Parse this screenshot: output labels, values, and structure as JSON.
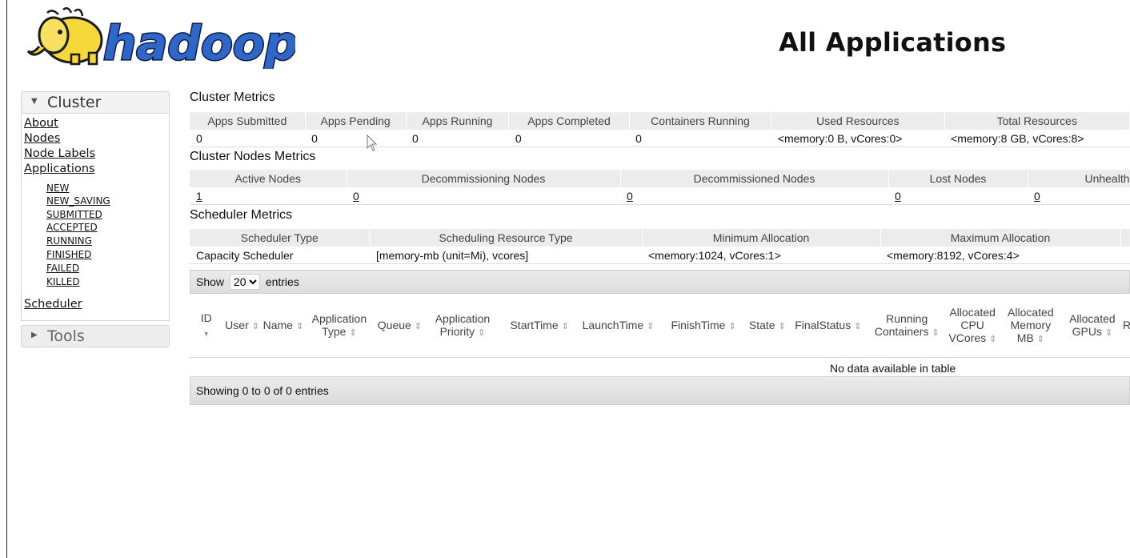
{
  "header": {
    "logo_text": "hadoop",
    "title": "All Applications"
  },
  "sidebar": {
    "cluster_label": "Cluster",
    "links": [
      "About",
      "Nodes",
      "Node Labels",
      "Applications"
    ],
    "app_states": [
      "NEW",
      "NEW_SAVING",
      "SUBMITTED",
      "ACCEPTED",
      "RUNNING",
      "FINISHED",
      "FAILED",
      "KILLED"
    ],
    "scheduler_label": "Scheduler",
    "tools_label": "Tools"
  },
  "cluster_metrics": {
    "title": "Cluster Metrics",
    "headers": [
      "Apps Submitted",
      "Apps Pending",
      "Apps Running",
      "Apps Completed",
      "Containers Running",
      "Used Resources",
      "Total Resources"
    ],
    "values": [
      "0",
      "0",
      "0",
      "0",
      "0",
      "<memory:0 B, vCores:0>",
      "<memory:8 GB, vCores:8>"
    ]
  },
  "cluster_nodes_metrics": {
    "title": "Cluster Nodes Metrics",
    "headers": [
      "Active Nodes",
      "Decommissioning Nodes",
      "Decommissioned Nodes",
      "Lost Nodes",
      "Unhealth"
    ],
    "values": [
      "1",
      "0",
      "0",
      "0",
      "0"
    ]
  },
  "scheduler_metrics": {
    "title": "Scheduler Metrics",
    "headers": [
      "Scheduler Type",
      "Scheduling Resource Type",
      "Minimum Allocation",
      "Maximum Allocation"
    ],
    "values": [
      "Capacity Scheduler",
      "[memory-mb (unit=Mi), vcores]",
      "<memory:1024, vCores:1>",
      "<memory:8192, vCores:4>"
    ]
  },
  "apps_table": {
    "show_label": "Show",
    "page_size": "20",
    "entries_label": "entries",
    "columns": [
      {
        "label": "ID",
        "sort": "desc"
      },
      {
        "label": "User",
        "sort": "both"
      },
      {
        "label": "Name",
        "sort": "both"
      },
      {
        "label": "Application Type",
        "sort": "both"
      },
      {
        "label": "Queue",
        "sort": "both"
      },
      {
        "label": "Application Priority",
        "sort": "both"
      },
      {
        "label": "StartTime",
        "sort": "both"
      },
      {
        "label": "LaunchTime",
        "sort": "both"
      },
      {
        "label": "FinishTime",
        "sort": "both"
      },
      {
        "label": "State",
        "sort": "both"
      },
      {
        "label": "FinalStatus",
        "sort": "both"
      },
      {
        "label": "Running Containers",
        "sort": "both"
      },
      {
        "label": "Allocated CPU VCores",
        "sort": "both"
      },
      {
        "label": "Allocated Memory MB",
        "sort": "both"
      },
      {
        "label": "Allocated GPUs",
        "sort": "both"
      },
      {
        "label": "R",
        "sort": "both"
      }
    ],
    "empty_message": "No data available in table",
    "footer": "Showing 0 to 0 of 0 entries"
  }
}
